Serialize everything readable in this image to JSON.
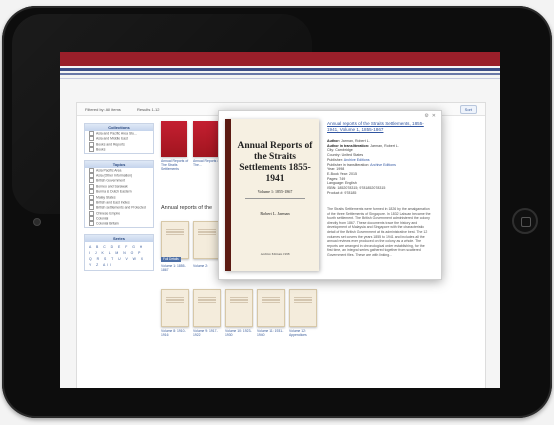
{
  "toolbar": {
    "left_text": "Filtered by: All items",
    "mid_text": "Results 1-12",
    "button": "Sort"
  },
  "sidebar": {
    "collections_title": "Collections",
    "collections": [
      "Asia and Pacific Area Stu...",
      "Asia and Middle East",
      "Books and Reports",
      "Books"
    ],
    "topics_title": "Topics",
    "topics": [
      "Asia Pacific Area",
      "Asia (Other Information)",
      "British Government",
      "Borneo and Sarawak",
      "Burma & Dutch Eastern",
      "Malay States",
      "British and East Indies",
      "British settlements and Protected",
      "Chinese Empire",
      "Colonial",
      "Colonial Britain"
    ],
    "series_title": "Series",
    "alphabet": "A B C D E F G H I J K L M N O P Q R S T U V W X Y Z All"
  },
  "content": {
    "section_title": "Annual reports of the",
    "red_captions": [
      "Annual Reports of The Straits Settlements",
      "Annual Reports of The..."
    ],
    "red_label": "Full Details",
    "row1_captions": [
      "Volume 1: 1855-1867",
      "Volume 2:",
      "",
      "",
      ""
    ],
    "tag": "Full Details",
    "row2_captions": [
      "Volume 8: 1910-1916",
      "Volume 9: 1917-1922",
      "Volume 10: 1923-1930",
      "Volume 11: 1931-1940",
      "Volume 12: Appendices"
    ]
  },
  "popup": {
    "cover_title": "Annual Reports of the Straits Settlements 1855-1941",
    "cover_volume": "Volume 1: 1855-1867",
    "cover_author": "Robert L. Jarman",
    "cover_publisher": "Archive Editions 1998",
    "link_title": "Annual reports of the Straits Settlements, 1855-1941, Volume 1, 1855-1867",
    "meta": [
      {
        "label": "Author:",
        "value": "Jarman, Robert L."
      },
      {
        "label": "Author in transliteration:",
        "value": "Jarman, Robert L."
      },
      {
        "label": "City:",
        "value": "Cambridge"
      },
      {
        "label": "Country:",
        "value": "United States"
      },
      {
        "label": "Publisher:",
        "value": "Archive Editions"
      },
      {
        "label": "Publisher in transliteration:",
        "value": "Archive Editions"
      },
      {
        "label": "Year:",
        "value": "1998"
      },
      {
        "label": "E-Book Year:",
        "value": "2015"
      },
      {
        "label": "Pages:",
        "value": "749"
      },
      {
        "label": "Language:",
        "value": "English"
      },
      {
        "label": "ISBN:",
        "value": "1852078315; 9781852078315"
      },
      {
        "label": "Product #:",
        "value": "978185"
      }
    ],
    "description": "The Straits Settlements were formed in 1826 by the amalgamation of the three Settlements of Singapore. In 1832 Labuan became the fourth settlement. The British Government administered the colony directly from 1867. These documents trace the history and development of Malaysia and Singapore with the characteristic detail of the British Government at its administrative best. The 12 volumes set covers the years 1855 to 1941 and includes all the annual reviews ever produced on the colony as a whole. The reports are arranged in chronological order establishing, for the first time, an integral series gathered together from scattered Government files. These are with linking..."
  }
}
